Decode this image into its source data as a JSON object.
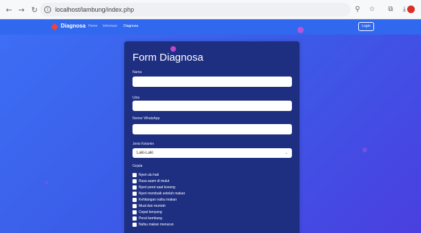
{
  "browser": {
    "url": "localhost/lambung/index.php",
    "icons": [
      "back-icon",
      "forward-icon",
      "reload-icon",
      "info-icon",
      "zoom-icon",
      "star-icon",
      "extensions-icon",
      "download-icon",
      "profile-icon"
    ]
  },
  "navbar": {
    "brand": "Diagnosa",
    "links": [
      "Home",
      "Informasi",
      "Diagnosa"
    ],
    "login": "Login"
  },
  "form": {
    "title": "Form Diagnosa",
    "fields": [
      {
        "label": "Nama",
        "value": ""
      },
      {
        "label": "Usia",
        "value": ""
      },
      {
        "label": "Nomor WhatsApp",
        "value": ""
      }
    ],
    "gender": {
      "label": "Jenis Kelamin",
      "selected": "Laki-Laki"
    },
    "symptoms_label": "Gejala",
    "symptoms": [
      "Nyeri ulu hati",
      "Rasa asam di mulut",
      "Nyeri perut saat kosong",
      "Nyeri membaik setelah makan",
      "Kehilangan nafsu makan",
      "Mual dan muntah",
      "Cepat kenyang",
      "Perut kembung",
      "Nafsu makan menurun"
    ]
  },
  "colors": {
    "page_bg": "#3d6ff5",
    "navbar": "#3168f0",
    "card": "#1e2f82",
    "bubble": "#d64fd6"
  }
}
